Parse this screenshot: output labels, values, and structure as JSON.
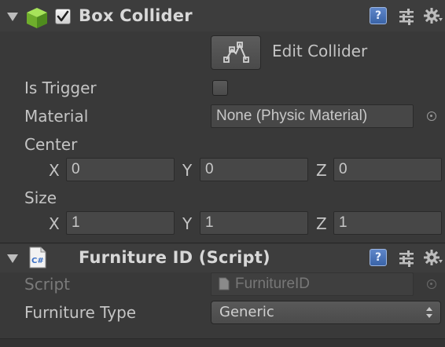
{
  "box_collider": {
    "title": "Box Collider",
    "edit_collider_label": "Edit Collider",
    "is_trigger_label": "Is Trigger",
    "material_label": "Material",
    "material_value": "None (Physic Material)",
    "center_label": "Center",
    "center": {
      "x_label": "X",
      "x": "0",
      "y_label": "Y",
      "y": "0",
      "z_label": "Z",
      "z": "0"
    },
    "size_label": "Size",
    "size": {
      "x_label": "X",
      "x": "1",
      "y_label": "Y",
      "y": "1",
      "z_label": "Z",
      "z": "1"
    }
  },
  "furniture_id": {
    "title": "Furniture ID (Script)",
    "script_icon_text": "C#",
    "script_label": "Script",
    "script_value": "FurnitureID",
    "furniture_type_label": "Furniture Type",
    "furniture_type_value": "Generic"
  },
  "icons": {
    "help": "?",
    "presets": "presets-icon",
    "settings": "gear-icon"
  }
}
